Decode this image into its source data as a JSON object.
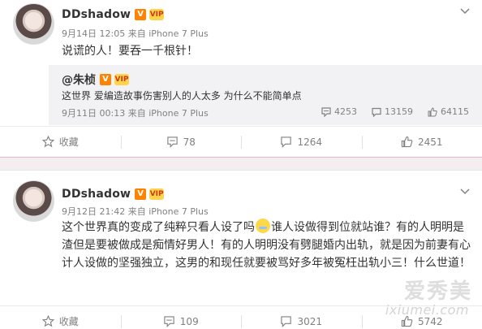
{
  "posts": [
    {
      "username": "DDshadow",
      "verified_badge": "V",
      "vip_badge": "VIP",
      "timestamp": "9月14日 12:05",
      "via_label": "来自",
      "source": "iPhone 7 Plus",
      "text": "说谎的人！要吞一千根针！",
      "repost": {
        "author": "@朱桢",
        "verified_badge": "V",
        "vip_badge": "VIP",
        "text": "这世界 爱编造故事伤害别人的人太多 为什么不能简单点",
        "timestamp": "9月11日 00:13",
        "via_label": "来自",
        "source": "iPhone 7 Plus",
        "reposts": "4253",
        "comments": "13159",
        "likes": "64115"
      },
      "actions": {
        "favorite": "收藏",
        "reposts": "78",
        "comments": "1264",
        "likes": "2451"
      }
    },
    {
      "username": "DDshadow",
      "verified_badge": "V",
      "vip_badge": "VIP",
      "timestamp": "9月12日 21:42",
      "via_label": "来自",
      "source": "iPhone 7 Plus",
      "text_part1": "这个世界真的变成了纯粹只看人设了吗",
      "text_part2": "谁人设做得到位就站谁？有的人明明是渣但是要被做成是痴情好男人！有的人明明没有劈腿婚内出轨，就是因为前妻有心计人设做的坚强独立，这男的和现任就要被骂好多年被冤枉出轨小三！什么世道！",
      "actions": {
        "favorite": "收藏",
        "reposts": "109",
        "comments": "3021",
        "likes": "5742"
      }
    }
  ],
  "watermark": {
    "top": "爱秀美",
    "bottom": "ixiumei.com"
  },
  "icons": {
    "favorite": "star-icon",
    "repost": "repost-icon",
    "comment": "comment-icon",
    "like": "thumbs-up-icon",
    "menu": "chevron-down-icon",
    "emoji": "crying-face-emoji"
  },
  "colors": {
    "verified": "#ff8200",
    "vip": "#ffd44a",
    "meta_text": "#808080",
    "repost_bg": "#f2f2f5"
  }
}
